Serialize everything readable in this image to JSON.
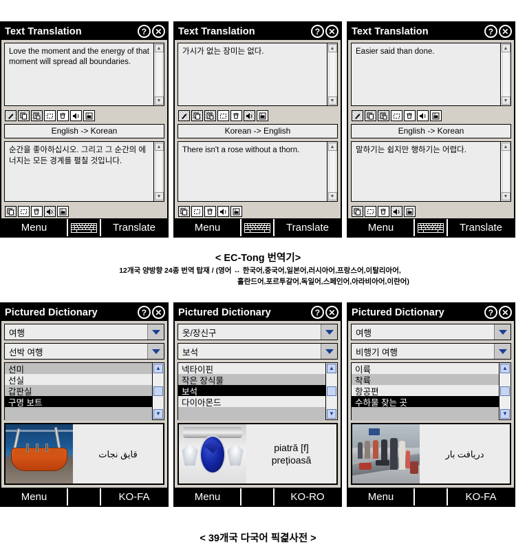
{
  "translator": {
    "window_title": "Text Translation",
    "help_glyph": "?",
    "close_glyph": "✕",
    "panels": [
      {
        "source_text": "Love the moment and the energy of that moment will spread all boundaries.",
        "direction": "English -> Korean",
        "result_text": "순간을 좋아하십시오. 그리고 그 순간의 에너지는 모든 경계를 펼칠 것입니다.",
        "speaker_active": false,
        "bottom_speaker_active": true,
        "menu_label": "Menu",
        "action_label": "Translate"
      },
      {
        "source_text": "가시가 없는 장미는 없다.",
        "direction": "Korean -> English",
        "result_text": "There isn't a rose without a thorn.",
        "speaker_active": true,
        "bottom_speaker_active": false,
        "menu_label": "Menu",
        "action_label": "Translate"
      },
      {
        "source_text": "Easier said than done.",
        "direction": "English -> Korean",
        "result_text": "말하기는 쉽지만 행하기는 어렵다.",
        "speaker_active": false,
        "bottom_speaker_active": true,
        "menu_label": "Menu",
        "action_label": "Translate"
      }
    ],
    "top_icons": [
      "pen-icon",
      "copy-icon",
      "paste-icon",
      "select-icon",
      "clear-icon",
      "speaker-icon",
      "keyboard-input-icon"
    ],
    "bottom_icons": [
      "copy-icon",
      "select-icon",
      "clear-icon",
      "speaker-icon",
      "keyboard-input-icon"
    ]
  },
  "caption_translator": {
    "title": "< EC-Tong 번역기>",
    "line1": "12개국 양방향 24종 번역 탑재 / (영어 ↔ 한국어,중국어,일본어,러시아어,프랑스어,이탈리아어,",
    "line2": "홀란드어,포르투갈어,독일어,스페인어,아라비아어,이란어)"
  },
  "dictionary": {
    "window_title": "Pictured Dictionary",
    "help_glyph": "?",
    "close_glyph": "✕",
    "panels": [
      {
        "category": "여행",
        "subcategory": "선박 여행",
        "items": [
          "선미",
          "선실",
          "갑판실",
          "구명 보트"
        ],
        "selected_index": 3,
        "word": "قایق نجات",
        "picture": "lifeboat-photo",
        "menu_label": "Menu",
        "lang_pair": "KO-FA"
      },
      {
        "category": "옷/장신구",
        "subcategory": "보석",
        "items": [
          "넥타이핀",
          "작은 장식물",
          "보석",
          "다이아몬드"
        ],
        "selected_index": 2,
        "word": "piatră [f]\nprețioasă",
        "picture": "sapphire-ring-photo",
        "menu_label": "Menu",
        "lang_pair": "KO-RO"
      },
      {
        "category": "여행",
        "subcategory": "비행기 여행",
        "items": [
          "이륙",
          "착륙",
          "항공편",
          "수하물 찾는 곳"
        ],
        "selected_index": 3,
        "word": "دریافت بار",
        "picture": "baggage-claim-photo",
        "menu_label": "Menu",
        "lang_pair": "KO-FA"
      }
    ]
  },
  "caption_dictionary": {
    "title": "< 39개국 다국어 픽겵사전 >"
  },
  "colors": {
    "titlebar_bg": "#000000",
    "panel_bg": "#d4d0c8",
    "field_bg": "#ececec",
    "selection_bg": "#000000",
    "alt_row_bg": "#bfbfbf",
    "arrow_blue": "#1c3f94",
    "scroll_blue": "#c7d5f2"
  }
}
